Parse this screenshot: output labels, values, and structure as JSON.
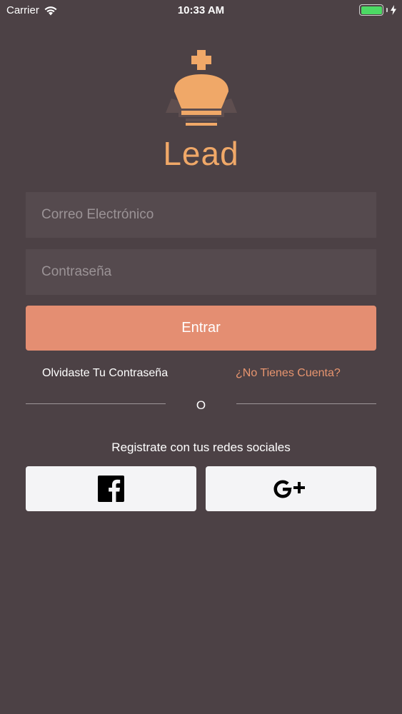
{
  "status_bar": {
    "carrier": "Carrier",
    "time": "10:33 AM",
    "battery_level": 1.0
  },
  "logo": {
    "text": "Lead",
    "icon": "crown-icon",
    "color": "#f0a868"
  },
  "login_form": {
    "email_placeholder": "Correo Electrónico",
    "email_value": "",
    "password_placeholder": "Contraseña",
    "password_value": "",
    "submit_label": "Entrar",
    "forgot_password": "Olvidaste Tu Contraseña",
    "no_account": "¿No Tienes Cuenta?",
    "separator": "O"
  },
  "social": {
    "caption": "Registrate con tus redes sociales",
    "buttons": [
      {
        "name": "Facebook",
        "icon": "facebook-icon"
      },
      {
        "name": "Google+",
        "icon": "google-plus-icon"
      }
    ]
  },
  "colors": {
    "background": "#4c4145",
    "field_background": "#554a4e",
    "accent": "#e48e72",
    "link": "#e8956f"
  }
}
